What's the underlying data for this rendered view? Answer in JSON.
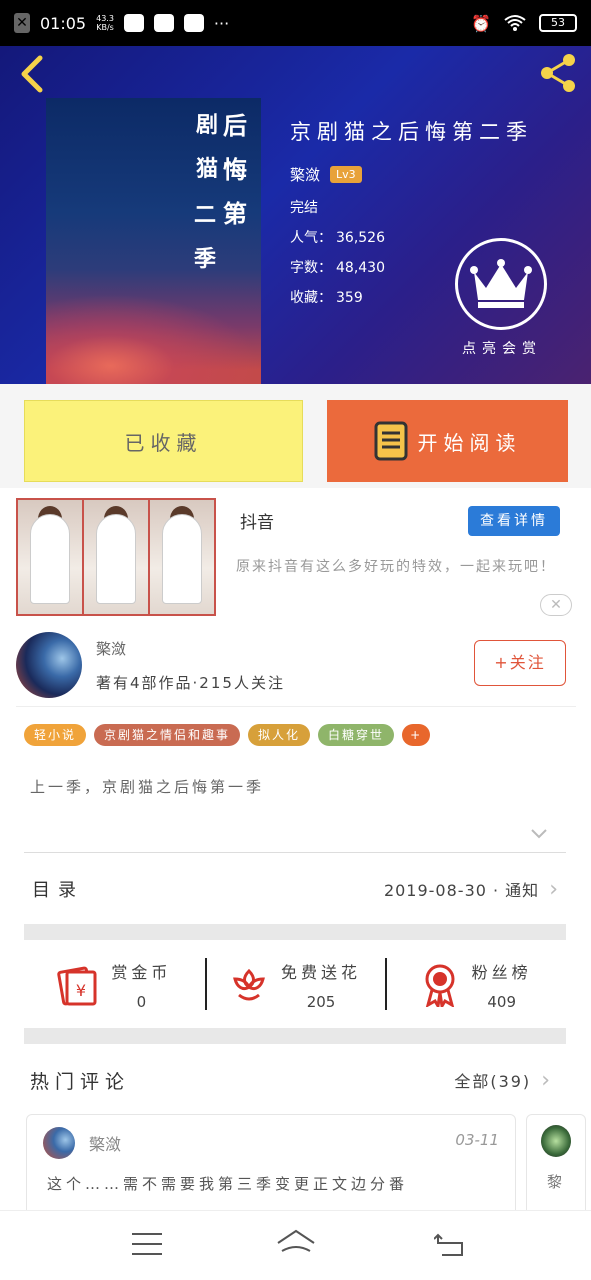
{
  "status_bar": {
    "time": "01:05",
    "speed_value": "43.3",
    "speed_unit": "KB/s",
    "battery": "53"
  },
  "book": {
    "title": "京剧猫之后悔第二季",
    "cover_col1": "剧猫",
    "cover_col2": "二季",
    "cover_col3": "后悔第",
    "author": "檠潋",
    "level": "Lv3",
    "status": "完结",
    "popularity_label": "人气：",
    "popularity": "36,526",
    "words_label": "字数：",
    "words": "48,430",
    "collections_label": "收藏：",
    "collections": "359",
    "reward_label": "点亮会赏"
  },
  "actions": {
    "collected_label": "已收藏",
    "read_label": "开始阅读"
  },
  "ad": {
    "title": "抖音",
    "button": "查看详情",
    "description": "原来抖音有这么多好玩的特效，一起来玩吧！",
    "close": "✕"
  },
  "author_card": {
    "name": "檠潋",
    "meta": "著有4部作品·215人关注",
    "follow": "+关注"
  },
  "tags": [
    "轻小说",
    "京剧猫之情侣和趣事",
    "拟人化",
    "白糖穿世",
    "+"
  ],
  "summary": "上一季，京剧猫之后悔第一季",
  "catalog": {
    "label": "目录",
    "update": "2019-08-30 · 通知"
  },
  "stats": [
    {
      "label": "赏金币",
      "value": "0",
      "icon": "red-envelope-icon"
    },
    {
      "label": "免费送花",
      "value": "205",
      "icon": "flower-icon"
    },
    {
      "label": "粉丝榜",
      "value": "409",
      "icon": "medal-icon"
    }
  ],
  "hot_comments": {
    "title": "热门评论",
    "all": "全部(39)"
  },
  "comments": [
    {
      "name": "檠潋",
      "date": "03-11",
      "text": "这个……需不需要我第三季变更正文边分番"
    },
    {
      "name": "黎"
    }
  ],
  "colors": {
    "accent_orange": "#eb6a3c",
    "collected_yellow": "#fbf27a",
    "link_blue": "#2b7bd8",
    "back_yellow": "#f5d34a"
  }
}
